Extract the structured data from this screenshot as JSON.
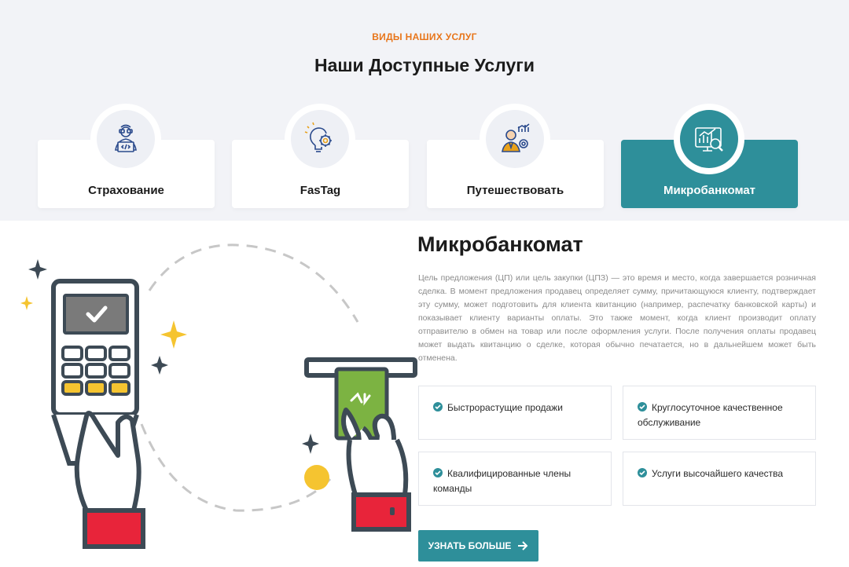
{
  "header": {
    "eyebrow": "ВИДЫ НАШИХ УСЛУГ",
    "title": "Наши Доступные Услуги"
  },
  "services": [
    {
      "label": "Страхование",
      "icon": "programmer-icon",
      "active": false
    },
    {
      "label": "FasTag",
      "icon": "idea-gear-icon",
      "active": false
    },
    {
      "label": "Путешествовать",
      "icon": "business-growth-icon",
      "active": false
    },
    {
      "label": "Микробанкомат",
      "icon": "analytics-search-icon",
      "active": true
    }
  ],
  "detail": {
    "title": "Микробанкомат",
    "text": "Цель предложения (ЦП) или цель закупки (ЦПЗ) — это время и место, когда завершается розничная сделка. В момент предложения продавец определяет сумму, причитающуюся клиенту, подтверждает эту сумму, может подготовить для клиента квитанцию (например, распечатку банковской карты) и показывает клиенту варианты оплаты. Это также момент, когда клиент производит оплату отправителю в обмен на товар или после оформления услуги. После получения оплаты продавец может выдать квитанцию о сделке, которая обычно печатается, но в дальнейшем может быть отменена.",
    "features": [
      "Быстрорастущие продажи",
      "Круглосуточное качественное обслуживание",
      "Квалифицированные члены команды",
      "Услуги высочайшего качества"
    ],
    "cta_label": "УЗНАТЬ БОЛЬШЕ"
  },
  "colors": {
    "accent": "#2e8f9a",
    "eyebrow": "#e8751a",
    "band": "#f2f3f7"
  }
}
